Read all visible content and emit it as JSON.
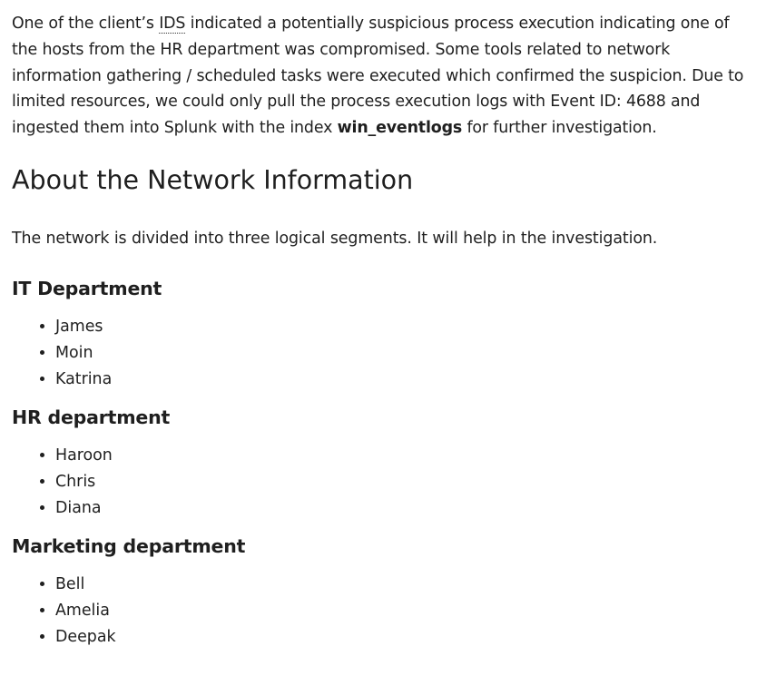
{
  "intro": {
    "part1": "One of the client’s ",
    "abbr": "IDS",
    "part2": " indicated a potentially suspicious process execution indicating one of the hosts from the HR department was compromised. Some tools related to network information gathering / scheduled tasks were executed which confirmed the suspicion. Due to limited resources, we could only pull the process execution logs with Event ID: 4688 and ingested them into Splunk with the index ",
    "index_name": "win_eventlogs",
    "part3": " for further investigation."
  },
  "section": {
    "title": "About the Network Information",
    "lead": "The network is divided into three logical segments. It will help in the investigation."
  },
  "departments": [
    {
      "name": "IT Department",
      "members": [
        "James",
        "Moin",
        "Katrina"
      ]
    },
    {
      "name": "HR department",
      "members": [
        "Haroon",
        "Chris",
        "Diana"
      ]
    },
    {
      "name": "Marketing department",
      "members": [
        "Bell",
        "Amelia",
        "Deepak"
      ]
    }
  ]
}
